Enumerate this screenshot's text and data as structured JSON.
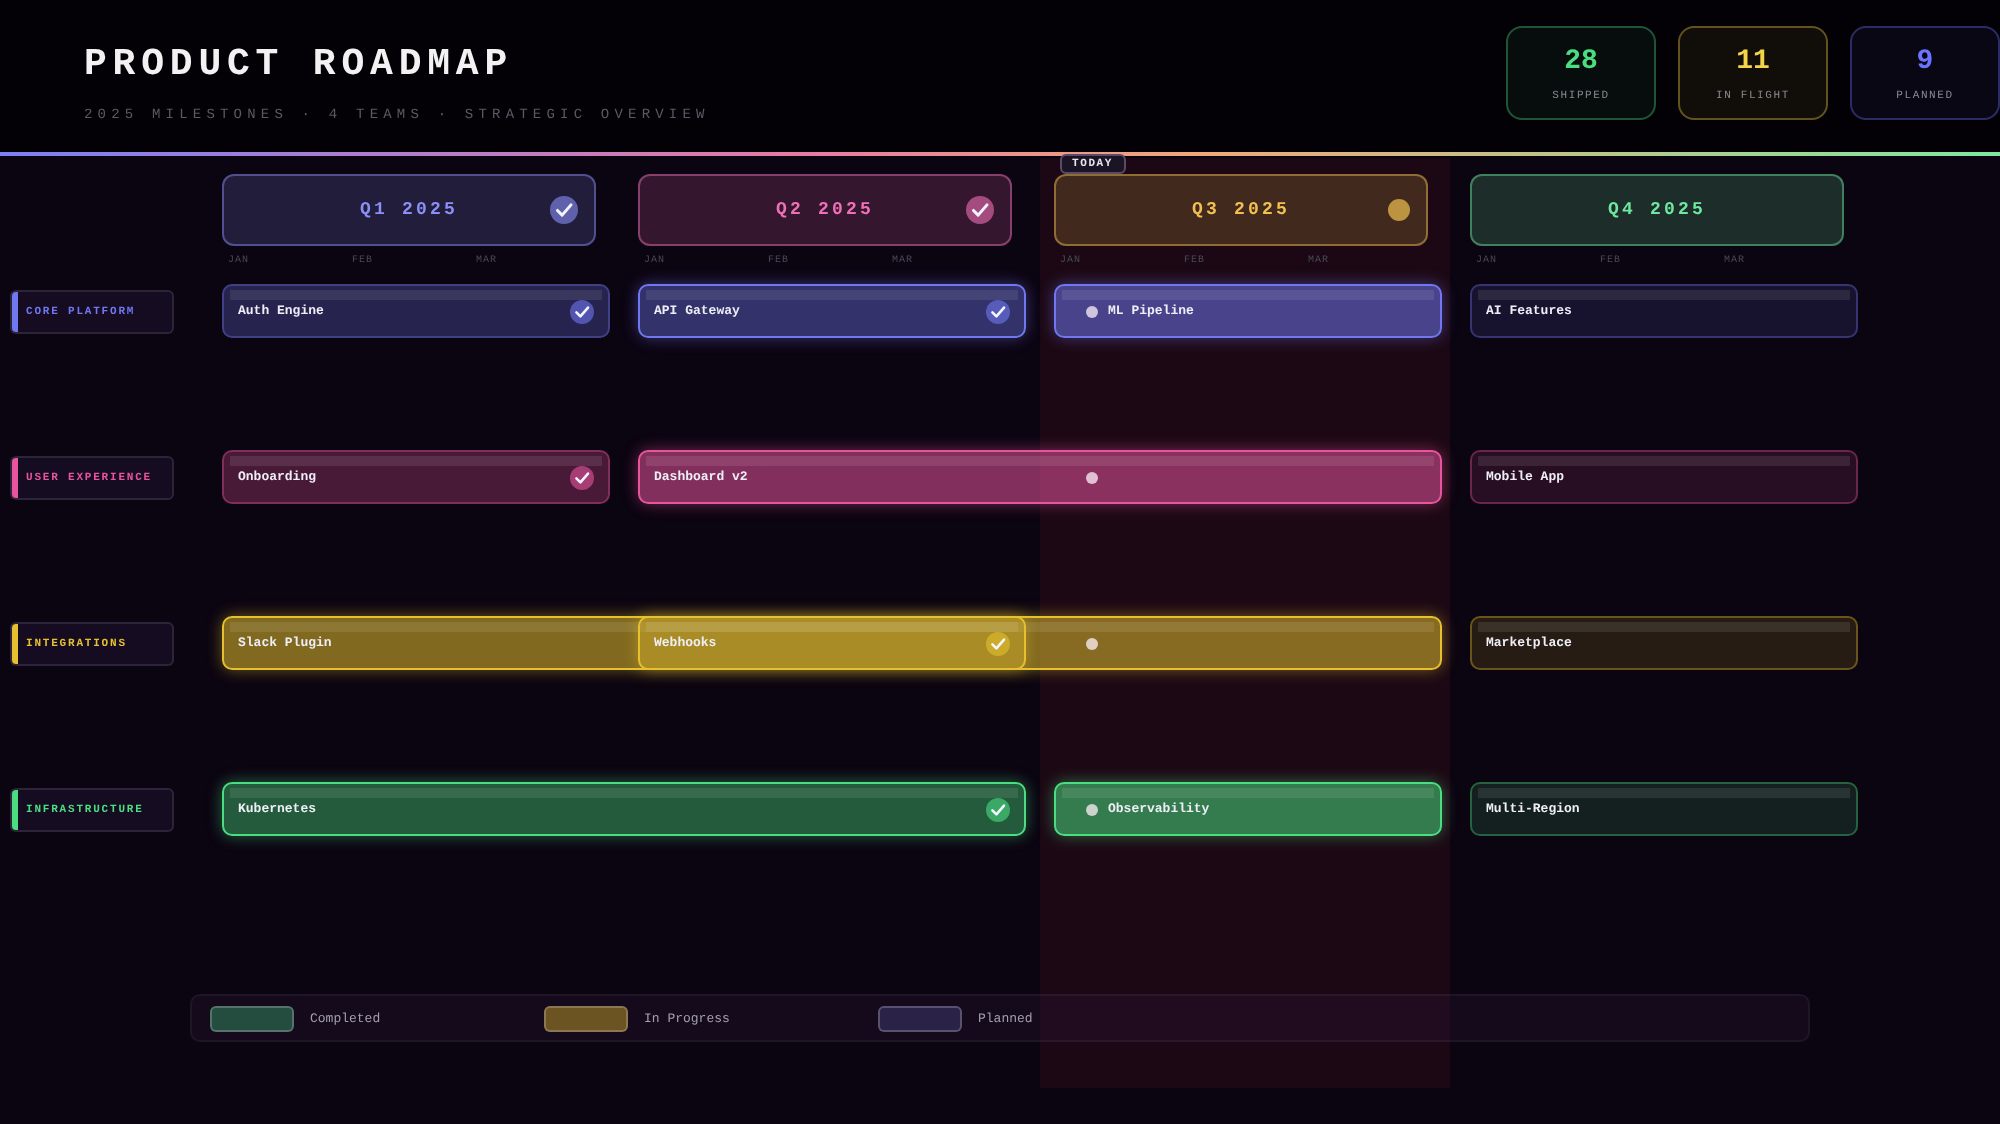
{
  "header": {
    "title": "PRODUCT ROADMAP",
    "subtitle": "2025 MILESTONES · 4 TEAMS · STRATEGIC OVERVIEW"
  },
  "stats": [
    {
      "value": "28",
      "label": "SHIPPED",
      "color": "#4ade80"
    },
    {
      "value": "11",
      "label": "IN FLIGHT",
      "color": "#f5d547"
    },
    {
      "value": "9",
      "label": "PLANNED",
      "color": "#6b74ff"
    }
  ],
  "today_label": "TODAY",
  "quarters": [
    {
      "label": "Q1 2025",
      "completed": true,
      "in_progress": false,
      "current": false,
      "color": "#8b8ff8",
      "months": [
        "JAN",
        "FEB",
        "MAR"
      ]
    },
    {
      "label": "Q2 2025",
      "completed": true,
      "in_progress": false,
      "current": false,
      "color": "#f070b8",
      "months": [
        "JAN",
        "FEB",
        "MAR"
      ]
    },
    {
      "label": "Q3 2025",
      "completed": false,
      "in_progress": true,
      "current": true,
      "color": "#f0c050",
      "months": [
        "JAN",
        "FEB",
        "MAR"
      ]
    },
    {
      "label": "Q4 2025",
      "completed": false,
      "in_progress": false,
      "current": false,
      "color": "#6ee7a0",
      "months": [
        "JAN",
        "FEB",
        "MAR"
      ]
    }
  ],
  "teams": [
    {
      "name": "CORE PLATFORM",
      "color": "#7077f0",
      "milestones": [
        {
          "title": "Auth Engine",
          "kind": "short",
          "completed": true,
          "in_progress": false,
          "highlighted": false
        },
        {
          "title": "API Gateway",
          "kind": "short",
          "completed": true,
          "in_progress": false,
          "highlighted": true
        },
        {
          "title": "ML Pipeline",
          "kind": "short",
          "completed": false,
          "in_progress": true,
          "highlighted": true
        },
        {
          "title": "AI Features",
          "kind": "short",
          "completed": false,
          "in_progress": false,
          "highlighted": false
        }
      ]
    },
    {
      "name": "USER EXPERIENCE",
      "color": "#e8559e",
      "milestones": [
        {
          "title": "Onboarding",
          "kind": "short",
          "completed": true,
          "in_progress": false,
          "highlighted": false
        },
        {
          "title": "Dashboard v2",
          "kind": "medium",
          "completed": false,
          "in_progress": true,
          "highlighted": true
        },
        {
          "title": "Mobile App",
          "kind": "short",
          "completed": false,
          "in_progress": false,
          "highlighted": false
        }
      ]
    },
    {
      "name": "INTEGRATIONS",
      "color": "#e6c02e",
      "milestones": [
        {
          "title": "Slack Plugin",
          "kind": "long",
          "completed": false,
          "in_progress": true,
          "highlighted": true,
          "children": [
            {
              "title": "Webhooks",
              "kind": "short",
              "completed": true,
              "in_progress": false,
              "highlighted": true
            }
          ]
        },
        {
          "title": "Marketplace",
          "kind": "short",
          "completed": false,
          "in_progress": false,
          "highlighted": false
        }
      ]
    },
    {
      "name": "INFRASTRUCTURE",
      "color": "#4ade80",
      "milestones": [
        {
          "title": "Kubernetes",
          "kind": "medium",
          "completed": true,
          "in_progress": false,
          "highlighted": true
        },
        {
          "title": "Observability",
          "kind": "short",
          "completed": false,
          "in_progress": true,
          "highlighted": true
        },
        {
          "title": "Multi-Region",
          "kind": "short",
          "completed": false,
          "in_progress": false,
          "highlighted": false
        }
      ]
    }
  ],
  "legend": [
    {
      "label": "Completed",
      "color": "#244c3f"
    },
    {
      "label": "In Progress",
      "color": "#6b5322"
    },
    {
      "label": "Planned",
      "color": "#2a2247"
    }
  ]
}
